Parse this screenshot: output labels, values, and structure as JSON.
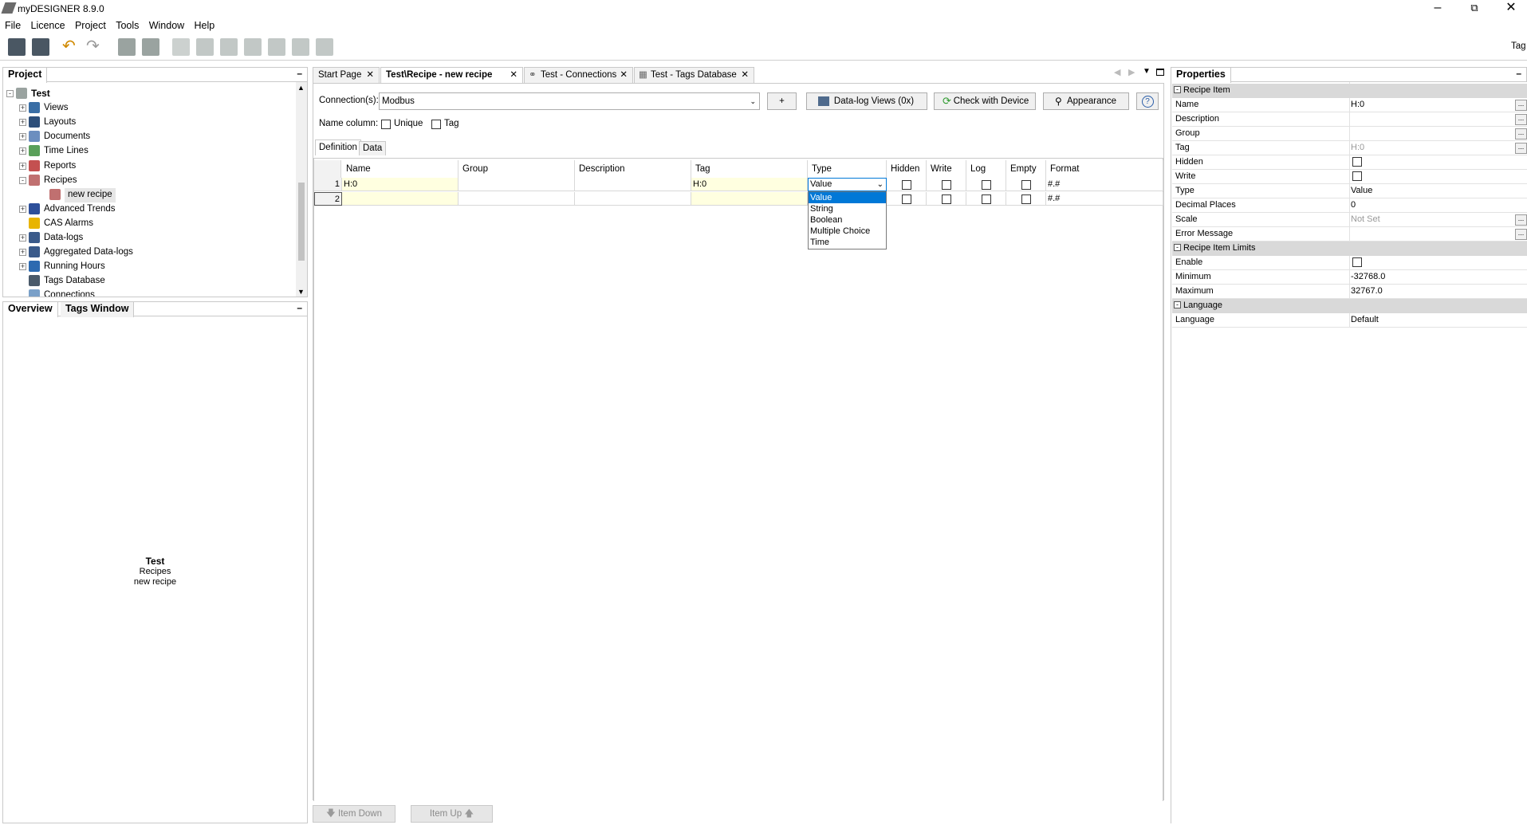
{
  "window": {
    "title": "myDESIGNER 8.9.0"
  },
  "menu": [
    "File",
    "Licence",
    "Project",
    "Tools",
    "Window",
    "Help"
  ],
  "toolbar": {
    "right_label": "Tag"
  },
  "project_panel": {
    "title": "Project",
    "tree": [
      {
        "label": "Test",
        "bold": true
      },
      {
        "label": "Views"
      },
      {
        "label": "Layouts"
      },
      {
        "label": "Documents"
      },
      {
        "label": "Time Lines"
      },
      {
        "label": "Reports"
      },
      {
        "label": "Recipes"
      },
      {
        "label": "new recipe",
        "selected": true
      },
      {
        "label": "Advanced Trends"
      },
      {
        "label": "CAS Alarms"
      },
      {
        "label": "Data-logs"
      },
      {
        "label": "Aggregated Data-logs"
      },
      {
        "label": "Running Hours"
      },
      {
        "label": "Tags Database"
      },
      {
        "label": "Connections"
      }
    ]
  },
  "overview_panel": {
    "tabs": [
      "Overview",
      "Tags Window"
    ],
    "lines": [
      "Test",
      "Recipes",
      "new recipe"
    ]
  },
  "doc_tabs": [
    "Start Page",
    "Test\\Recipe - new recipe",
    "Test - Connections",
    "Test - Tags Database"
  ],
  "editor": {
    "connections_label": "Connection(s):",
    "connection_value": "Modbus",
    "add_label": "+",
    "datalog_label": "Data-log Views (0x)",
    "check_label": "Check with Device",
    "appearance_label": "Appearance",
    "help_label": "?",
    "name_column_label": "Name column:",
    "unique_label": "Unique",
    "tag_label": "Tag",
    "subtabs": [
      "Definition",
      "Data"
    ],
    "columns": [
      "Name",
      "Group",
      "Description",
      "Tag",
      "Type",
      "Hidden",
      "Write",
      "Log",
      "Empty",
      "Format"
    ],
    "rows": [
      {
        "num": "1",
        "name": "H:0",
        "group": "",
        "description": "",
        "tag": "H:0",
        "type": "Value",
        "format": "#.#"
      },
      {
        "num": "2",
        "name": "",
        "group": "",
        "description": "",
        "tag": "",
        "type": "",
        "format": "#.#"
      }
    ],
    "type_options": [
      "Value",
      "String",
      "Boolean",
      "Multiple Choice",
      "Time"
    ],
    "type_selected": "Value",
    "item_down": "Item Down",
    "item_up": "Item Up"
  },
  "properties": {
    "title": "Properties",
    "sections": [
      {
        "name": "Recipe Item",
        "rows": [
          {
            "key": "Name",
            "value": "H:0"
          },
          {
            "key": "Description",
            "value": ""
          },
          {
            "key": "Group",
            "value": ""
          },
          {
            "key": "Tag",
            "value": "H:0"
          },
          {
            "key": "Hidden",
            "value": ""
          },
          {
            "key": "Write",
            "value": ""
          },
          {
            "key": "Type",
            "value": "Value"
          },
          {
            "key": "Decimal Places",
            "value": "0"
          },
          {
            "key": "Scale",
            "value": "Not Set"
          },
          {
            "key": "Error Message",
            "value": ""
          }
        ]
      },
      {
        "name": "Recipe Item Limits",
        "rows": [
          {
            "key": "Enable",
            "value": ""
          },
          {
            "key": "Minimum",
            "value": "-32768.0"
          },
          {
            "key": "Maximum",
            "value": "32767.0"
          }
        ]
      },
      {
        "name": "Language",
        "rows": [
          {
            "key": "Language",
            "value": "Default"
          }
        ]
      }
    ]
  },
  "colors": {
    "selection": "#0078d7",
    "highlight_cell": "#ffffe0",
    "section_bg": "#d9d9d9"
  }
}
